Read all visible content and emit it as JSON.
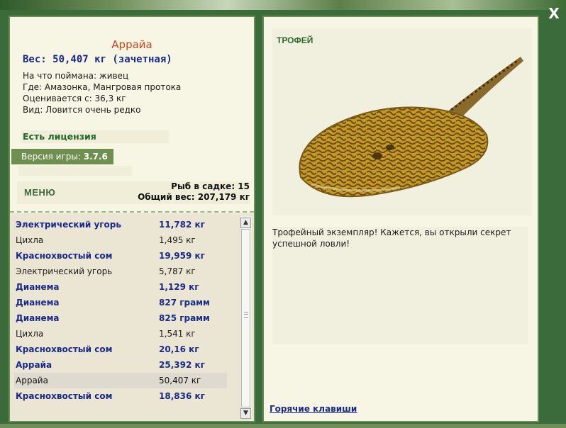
{
  "window": {
    "close_label": "X"
  },
  "fish": {
    "name": "Аррайа",
    "weight_line": "Вес: 50,407 кг (зачетная)",
    "caught_on": "На что поймана: живец",
    "location": "Где: Амазонка, Мангровая протока",
    "value": "Оценивается с: 36,3 кг",
    "rarity": "Вид: Ловится очень редко"
  },
  "license": "Есть лицензия",
  "version": {
    "label": "Версия игры:",
    "value": "3.7.6"
  },
  "menu_label": "МЕНЮ",
  "keepnet": {
    "count_line": "Рыб в садке: 15",
    "total_line": "Общий вес: 207,179 кг"
  },
  "catch_list": [
    {
      "name": "Электрический угорь",
      "weight": "11,782 кг",
      "style": "bold"
    },
    {
      "name": "Цихла",
      "weight": "1,495 кг",
      "style": "normal"
    },
    {
      "name": "Краснохвостый сом",
      "weight": "19,959 кг",
      "style": "bold"
    },
    {
      "name": "Электрический угорь",
      "weight": "5,787 кг",
      "style": "normal"
    },
    {
      "name": "Дианема",
      "weight": "1,129 кг",
      "style": "bold"
    },
    {
      "name": "Дианема",
      "weight": "827 грамм",
      "style": "bold"
    },
    {
      "name": "Дианема",
      "weight": "825 грамм",
      "style": "bold"
    },
    {
      "name": "Цихла",
      "weight": "1,541 кг",
      "style": "normal"
    },
    {
      "name": "Краснохвостый сом",
      "weight": "20,16 кг",
      "style": "bold"
    },
    {
      "name": "Аррайа",
      "weight": "25,392 кг",
      "style": "bold"
    },
    {
      "name": "Аррайа",
      "weight": "50,407 кг",
      "style": "selected"
    },
    {
      "name": "Краснохвостый сом",
      "weight": "18,836 кг",
      "style": "bold"
    }
  ],
  "trophy": {
    "badge": "ТРОФЕЙ",
    "image_icon": "stingray-image",
    "description": "Трофейный экземпляр! Кажется, вы открыли секрет успешной ловли!"
  },
  "hotkeys_label": "Горячие клавиши",
  "colors": {
    "panel_border": "#6a8d55",
    "panel_bg": "#f7f5e3",
    "accent_title": "#c8461a",
    "link": "#1a2a8a"
  }
}
